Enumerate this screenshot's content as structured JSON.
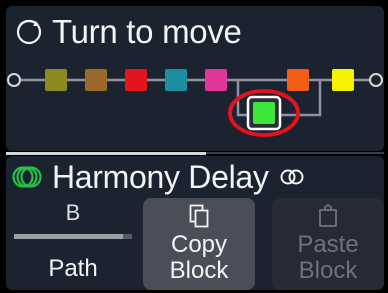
{
  "header": {
    "title": "Turn to move",
    "title_icon": "rotate-knob-icon"
  },
  "signal_chain": {
    "blocks": [
      {
        "color": "#8a8a1e",
        "state": "bypassed"
      },
      {
        "color": "#9a6a2c",
        "state": "bypassed"
      },
      {
        "color": "#e3141d",
        "state": "active"
      },
      {
        "color": "#1e8fa0",
        "state": "bypassed"
      },
      {
        "color": "#e0369a",
        "state": "active"
      },
      {
        "color": "#f25e18",
        "state": "active"
      },
      {
        "color": "#f6f300",
        "state": "active"
      }
    ],
    "selected_block": {
      "color": "#3ee63a",
      "state": "selected",
      "path": "B"
    },
    "highlight_color": "#e0141c"
  },
  "model": {
    "name": "Harmony Delay",
    "category_icon": "delay-category-icon",
    "stereo_icon": "stereo-link-icon",
    "accent_color": "#25c447"
  },
  "controls": {
    "path": {
      "label": "Path",
      "value": "B",
      "level": 0.92
    },
    "copy": {
      "label_line1": "Copy",
      "label_line2": "Block",
      "icon": "copy-icon",
      "enabled": true
    },
    "paste": {
      "label_line1": "Paste",
      "label_line2": "Block",
      "icon": "paste-icon",
      "enabled": false
    }
  }
}
